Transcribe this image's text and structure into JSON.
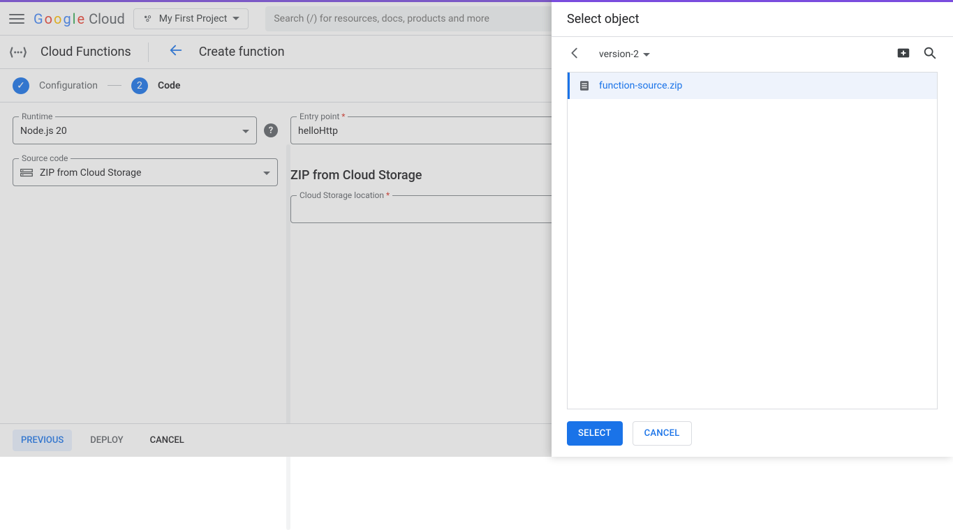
{
  "header": {
    "logo_brand": "Google",
    "logo_product": "Cloud",
    "project_name": "My First Project",
    "search_placeholder": "Search (/) for resources, docs, products and more"
  },
  "subheader": {
    "service": "Cloud Functions",
    "page": "Create function"
  },
  "stepper": {
    "step1_label": "Configuration",
    "step2_number": "2",
    "step2_label": "Code"
  },
  "form": {
    "runtime_label": "Runtime",
    "runtime_value": "Node.js 20",
    "entry_label": "Entry point",
    "entry_value": "helloHttp",
    "source_label": "Source code",
    "source_value": "ZIP from Cloud Storage",
    "section_title": "ZIP from Cloud Storage",
    "location_label": "Cloud Storage location"
  },
  "footer": {
    "previous": "PREVIOUS",
    "deploy": "DEPLOY",
    "cancel": "CANCEL"
  },
  "panel": {
    "title": "Select object",
    "breadcrumb": "version-2",
    "file": "function-source.zip",
    "select": "SELECT",
    "cancel": "CANCEL"
  }
}
